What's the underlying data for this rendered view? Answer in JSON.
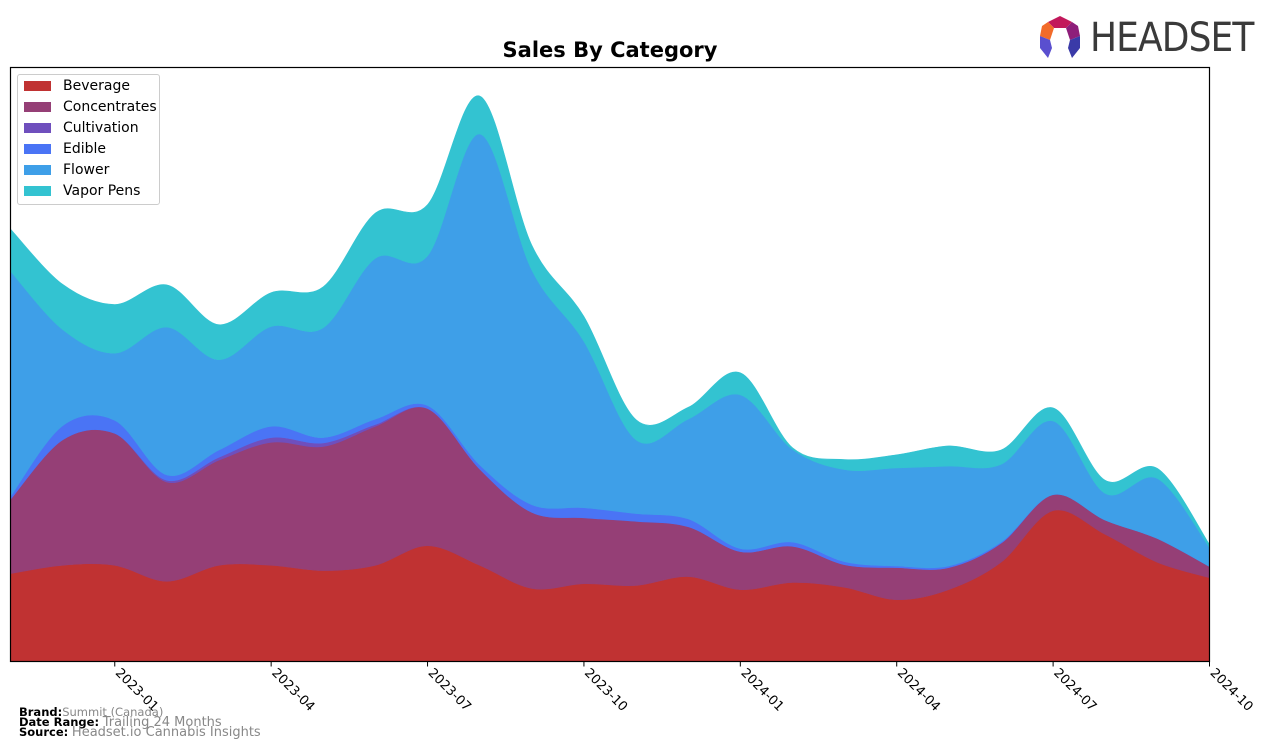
{
  "header": {
    "logo_text": "HEADSET"
  },
  "footer": {
    "brand_label": "Brand:",
    "brand_value": "Summit (Canada)",
    "date_range_label": "Date Range:",
    "date_range_value": "Trailing 24 Months",
    "source_label": "Source:",
    "source_value": "Headset.io Cannabis Insights"
  },
  "chart_data": {
    "type": "area",
    "stacked": true,
    "smooth": true,
    "title": "Sales By Category",
    "xlabel": "",
    "ylabel": "",
    "y_axis_visible": false,
    "grid": false,
    "legend_position": "top-left",
    "x": [
      "2022-11",
      "2022-12",
      "2023-01",
      "2023-02",
      "2023-03",
      "2023-04",
      "2023-05",
      "2023-06",
      "2023-07",
      "2023-08",
      "2023-09",
      "2023-10",
      "2023-11",
      "2023-12",
      "2024-01",
      "2024-02",
      "2024-03",
      "2024-04",
      "2024-05",
      "2024-06",
      "2024-07",
      "2024-08",
      "2024-09",
      "2024-10"
    ],
    "x_ticks": [
      "2023-01",
      "2023-04",
      "2023-07",
      "2023-10",
      "2024-01",
      "2024-04",
      "2024-07",
      "2024-10"
    ],
    "ylim": [
      0,
      100
    ],
    "series": [
      {
        "name": "Beverage",
        "color": "#c03232",
        "values": [
          14.8,
          16.2,
          16.2,
          13.5,
          16.2,
          16.2,
          15.3,
          16.2,
          19.5,
          16.2,
          12.3,
          13.1,
          12.8,
          14.3,
          12.1,
          13.3,
          12.5,
          10.4,
          12.1,
          16.7,
          25.4,
          21.4,
          16.7,
          14.1
        ]
      },
      {
        "name": "Concentrates",
        "color": "#953f76",
        "values": [
          12.5,
          21.1,
          22.2,
          16.7,
          17.7,
          20.7,
          20.9,
          23.4,
          23.1,
          16.2,
          12.8,
          11.1,
          10.8,
          8.4,
          6.4,
          6.1,
          3.8,
          5.4,
          3.7,
          3.2,
          2.7,
          2.4,
          4.0,
          1.9
        ]
      },
      {
        "name": "Cultivation",
        "color": "#6f4fbd",
        "values": [
          0,
          0,
          0,
          0.3,
          0.5,
          0.8,
          0.6,
          0.3,
          0,
          0,
          0,
          0,
          0,
          0,
          0,
          0,
          0,
          0,
          0,
          0,
          0,
          0,
          0,
          0
        ]
      },
      {
        "name": "Edible",
        "color": "#4a74f5",
        "values": [
          0.5,
          2.4,
          2.2,
          0.9,
          1.2,
          1.9,
          0.9,
          0.9,
          0.5,
          0.7,
          1.3,
          1.7,
          1.3,
          1.3,
          0.5,
          0.7,
          0.5,
          0.3,
          0.3,
          0.2,
          0,
          0,
          0,
          0
        ]
      },
      {
        "name": "Flower",
        "color": "#3e9fe8",
        "values": [
          37.9,
          16.2,
          11.3,
          24.9,
          15.2,
          16.8,
          18.5,
          27.1,
          25.2,
          55.7,
          39.5,
          28.0,
          12.4,
          16.8,
          25.9,
          15.6,
          15.5,
          16.5,
          16.8,
          13.1,
          12.4,
          4.5,
          10.1,
          3.2
        ]
      },
      {
        "name": "Vapor Pens",
        "color": "#33c3d1",
        "values": [
          7.1,
          7.6,
          8.2,
          7.1,
          5.9,
          5.7,
          6.9,
          7.6,
          8.6,
          6.4,
          4.2,
          4.2,
          3.4,
          2.0,
          3.7,
          0.3,
          1.7,
          2.2,
          3.4,
          2.4,
          2.2,
          2.2,
          1.7,
          0.5
        ]
      }
    ]
  }
}
